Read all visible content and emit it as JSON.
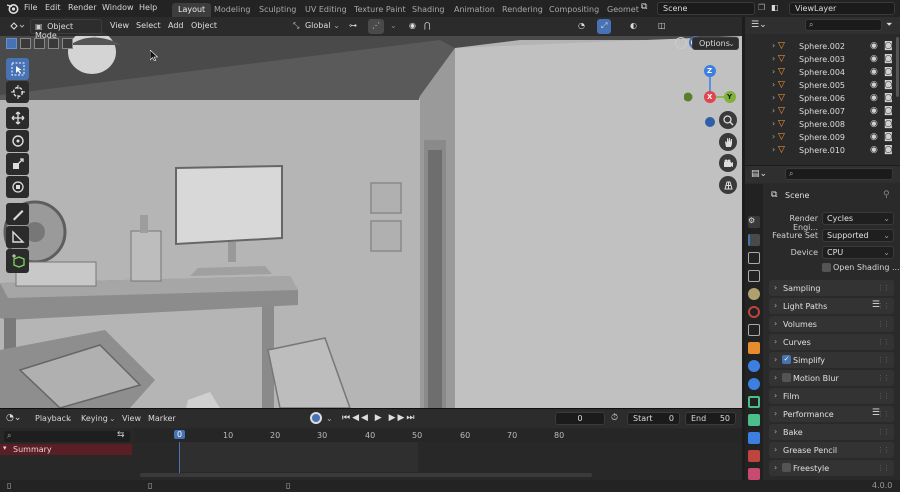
{
  "topbar": {
    "menus": [
      "File",
      "Edit",
      "Render",
      "Window",
      "Help"
    ],
    "workspace_tabs": [
      "Layout",
      "Modeling",
      "Sculpting",
      "UV Editing",
      "Texture Paint",
      "Shading",
      "Animation",
      "Rendering",
      "Compositing",
      "Geomet"
    ],
    "active_tab": "Layout",
    "scene_name": "Scene",
    "view_layer": "ViewLayer"
  },
  "viewport": {
    "mode": "Object Mode",
    "menus": [
      "View",
      "Select",
      "Add",
      "Object"
    ],
    "transform_orientation": "Global",
    "options_label": "Options",
    "gizmo_axes": {
      "z": "Z",
      "x": "X",
      "y": "Y"
    },
    "tools": [
      "select-box",
      "cursor",
      "move",
      "rotate",
      "scale",
      "transform",
      "annotate",
      "measure",
      "add-cube"
    ],
    "colors": {
      "active_tool": "#4772b3",
      "x_axis": "#e0454e",
      "y_axis": "#7fb23a",
      "z_axis": "#3c7fe0"
    }
  },
  "timeline": {
    "menus": [
      "Playback",
      "Keying",
      "View",
      "Marker"
    ],
    "current_frame": "0",
    "start_label": "Start",
    "start_value": "0",
    "end_label": "End",
    "end_value": "50",
    "ticks": [
      "0",
      "10",
      "20",
      "30",
      "40",
      "50",
      "60",
      "70",
      "80"
    ],
    "summary_label": "Summary"
  },
  "outliner": {
    "items": [
      "Sphere.002",
      "Sphere.003",
      "Sphere.004",
      "Sphere.005",
      "Sphere.006",
      "Sphere.007",
      "Sphere.008",
      "Sphere.009",
      "Sphere.010"
    ]
  },
  "properties": {
    "context": "Scene",
    "render_engine_label": "Render Engi...",
    "render_engine": "Cycles",
    "feature_set_label": "Feature Set",
    "feature_set": "Supported",
    "device_label": "Device",
    "device": "CPU",
    "open_shading_label": "Open Shading ...",
    "panels": [
      {
        "label": "Sampling",
        "checkbox": false
      },
      {
        "label": "Light Paths",
        "checkbox": false
      },
      {
        "label": "Volumes",
        "checkbox": false
      },
      {
        "label": "Curves",
        "checkbox": false
      },
      {
        "label": "Simplify",
        "checkbox": true
      },
      {
        "label": "Motion Blur",
        "checkbox": false
      },
      {
        "label": "Film",
        "checkbox": false
      },
      {
        "label": "Performance",
        "checkbox": false
      },
      {
        "label": "Bake",
        "checkbox": false
      },
      {
        "label": "Grease Pencil",
        "checkbox": false
      },
      {
        "label": "Freestyle",
        "checkbox": false
      }
    ]
  },
  "status": {
    "version": "4.0.0"
  }
}
